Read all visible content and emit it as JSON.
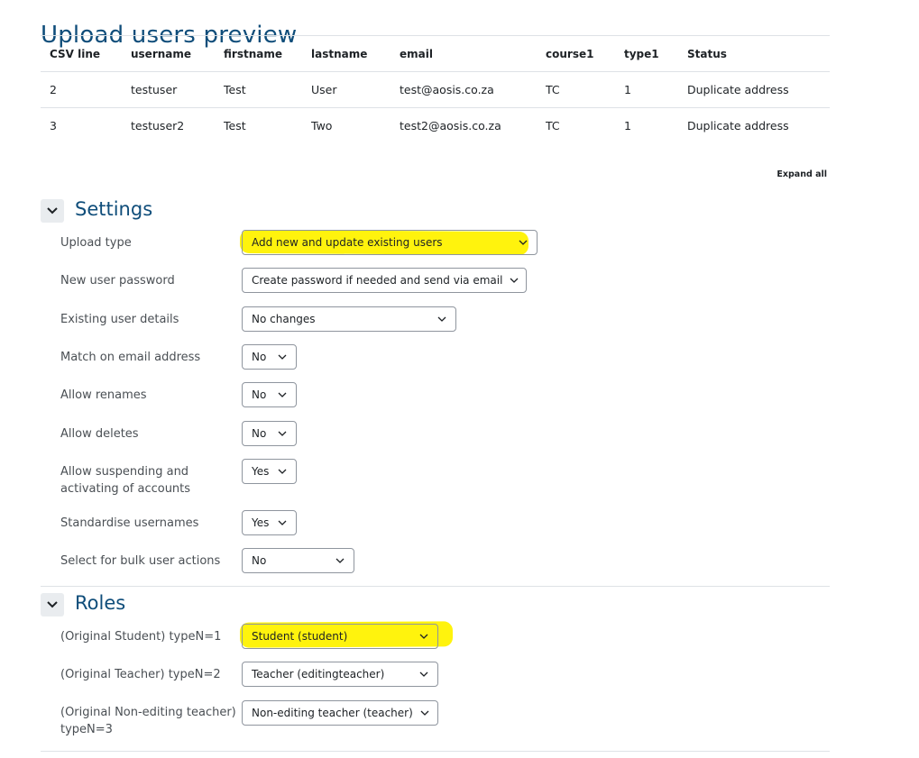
{
  "page": {
    "title": "Upload users preview"
  },
  "table": {
    "headers": [
      "CSV line",
      "username",
      "firstname",
      "lastname",
      "email",
      "course1",
      "type1",
      "Status"
    ],
    "rows": [
      [
        "2",
        "testuser",
        "Test",
        "User",
        "test@aosis.co.za",
        "TC",
        "1",
        "Duplicate address"
      ],
      [
        "3",
        "testuser2",
        "Test",
        "Two",
        "test2@aosis.co.za",
        "TC",
        "1",
        "Duplicate address"
      ]
    ]
  },
  "expand_all": "Expand all",
  "settings": {
    "title": "Settings",
    "fields": [
      {
        "label": "Upload type",
        "value": "Add new and update existing users"
      },
      {
        "label": "New user password",
        "value": "Create password if needed and send via email"
      },
      {
        "label": "Existing user details",
        "value": "No changes"
      },
      {
        "label": "Match on email address",
        "value": "No"
      },
      {
        "label": "Allow renames",
        "value": "No"
      },
      {
        "label": "Allow deletes",
        "value": "No"
      },
      {
        "label": "Allow suspending and activating of accounts",
        "value": "Yes"
      },
      {
        "label": "Standardise usernames",
        "value": "Yes"
      },
      {
        "label": "Select for bulk user actions",
        "value": "No"
      }
    ]
  },
  "roles": {
    "title": "Roles",
    "fields": [
      {
        "label": "(Original Student) typeN=1",
        "value": "Student (student)"
      },
      {
        "label": "(Original Teacher) typeN=2",
        "value": "Teacher (editingteacher)"
      },
      {
        "label": "(Original Non-editing teacher) typeN=3",
        "value": "Non-editing teacher (teacher)"
      }
    ]
  },
  "colors": {
    "title": "#0f4d7a",
    "highlight": "#fff200",
    "border": "#dee2e6"
  },
  "icons": {
    "toggle": "chevron-down-icon",
    "select": "chevron-down-icon"
  }
}
